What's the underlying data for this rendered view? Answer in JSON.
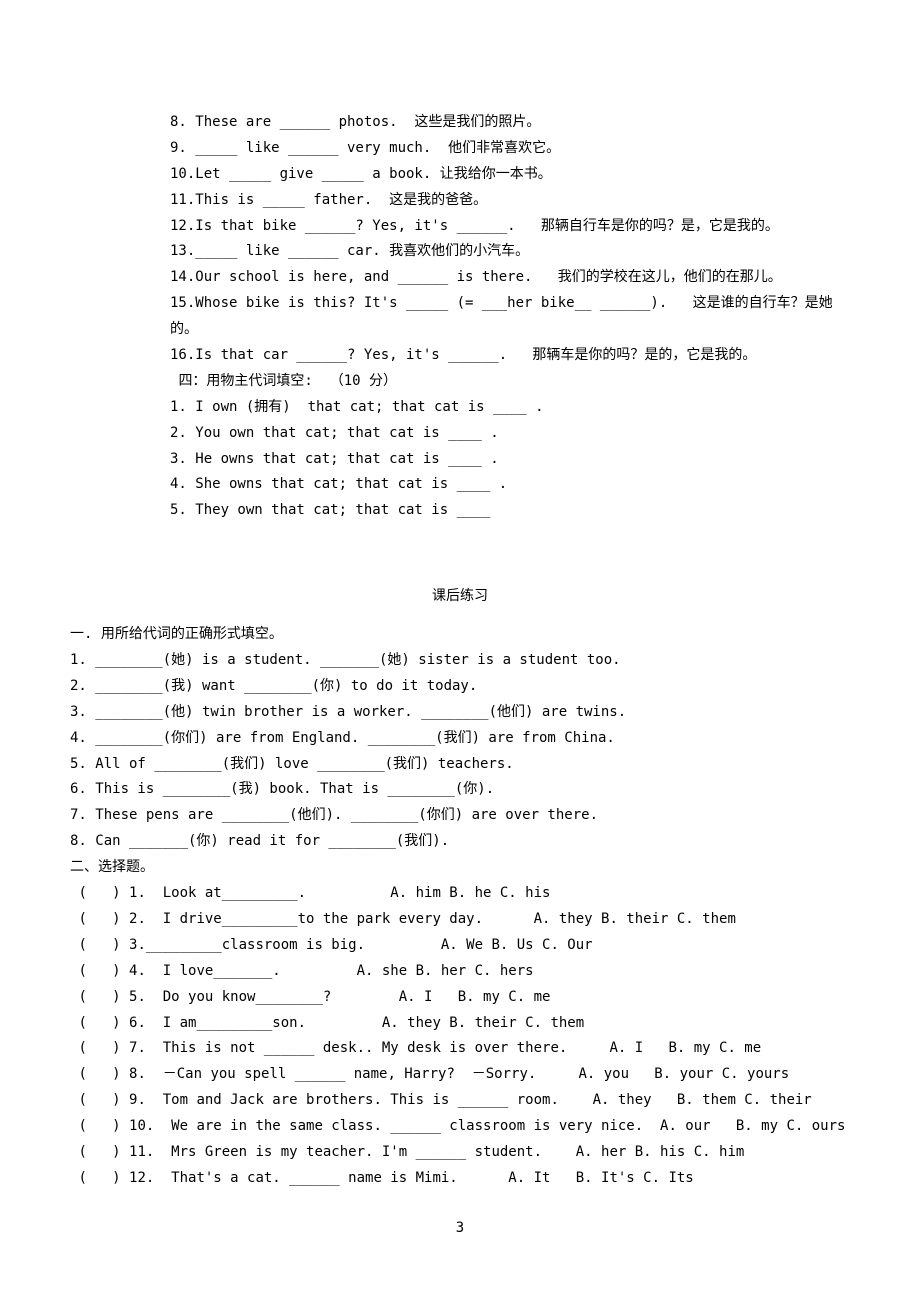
{
  "section_a": {
    "items": [
      "8. These are ______ photos.  这些是我们的照片。",
      "9. _____ like ______ very much.  他们非常喜欢它。",
      "10.Let _____ give _____ a book. 让我给你一本书。",
      "11.This is _____ father.  这是我的爸爸。",
      "12.Is that bike ______? Yes, it's ______.   那辆自行车是你的吗？是，它是我的。",
      "13._____ like ______ car. 我喜欢他们的小汽车。",
      "14.Our school is here, and ______ is there.   我们的学校在这儿，他们的在那儿。",
      "15.Whose bike is this? It's _____ (= ___her bike__ ______).   这是谁的自行车？是她的。",
      "16.Is that car ______? Yes, it's ______.   那辆车是你的吗？是的，它是我的。"
    ],
    "heading_four": " 四：用物主代词填空:  （10 分）",
    "subitems": [
      "1. I own (拥有)  that cat; that cat is ____ .",
      "2. You own that cat; that cat is ____ .",
      "3. He owns that cat; that cat is ____ .",
      "4. She owns that cat; that cat is ____ .",
      "5. They own that cat; that cat is ____"
    ]
  },
  "title_b": "课后练习",
  "section_b1_head": "一. 用所给代词的正确形式填空。",
  "section_b1_items": [
    "1. ________(她) is a student. _______(她) sister is a student too.",
    "2. ________(我) want ________(你) to do it today.",
    "3. ________(他) twin brother is a worker. ________(他们) are twins.",
    "4. ________(你们) are from England. ________(我们) are from China.",
    "5. All of ________(我们) love ________(我们) teachers.",
    "6. This is ________(我) book. That is ________(你).",
    "7. These pens are ________(他们). ________(你们) are over there.",
    "8. Can _______(你) read it for ________(我们)."
  ],
  "section_b2_head": "二、选择题。",
  "section_b2_items": [
    " (   ) 1.  Look at_________.          A. him B. he C. his",
    " (   ) 2.  I drive_________to the park every day.      A. they B. their C. them",
    " (   ) 3._________classroom is big.         A. We B. Us C. Our",
    " (   ) 4.  I love_______.         A. she B. her C. hers",
    " (   ) 5.  Do you know________?        A. I   B. my C. me",
    " (   ) 6.  I am_________son.         A. they B. their C. them",
    " (   ) 7.  This is not ______ desk.. My desk is over there.     A. I   B. my C. me",
    " (   ) 8.  －Can you spell ______ name, Harry?  －Sorry.     A. you   B. your C. yours",
    " (   ) 9.  Tom and Jack are brothers. This is ______ room.    A. they   B. them C. their",
    " (   ) 10.  We are in the same class. ______ classroom is very nice.  A. our   B. my C. ours",
    " (   ) 11.  Mrs Green is my teacher. I'm ______ student.    A. her B. his C. him",
    " (   ) 12.  That's a cat. ______ name is Mimi.      A. It   B. It's C. Its"
  ],
  "page": "3"
}
